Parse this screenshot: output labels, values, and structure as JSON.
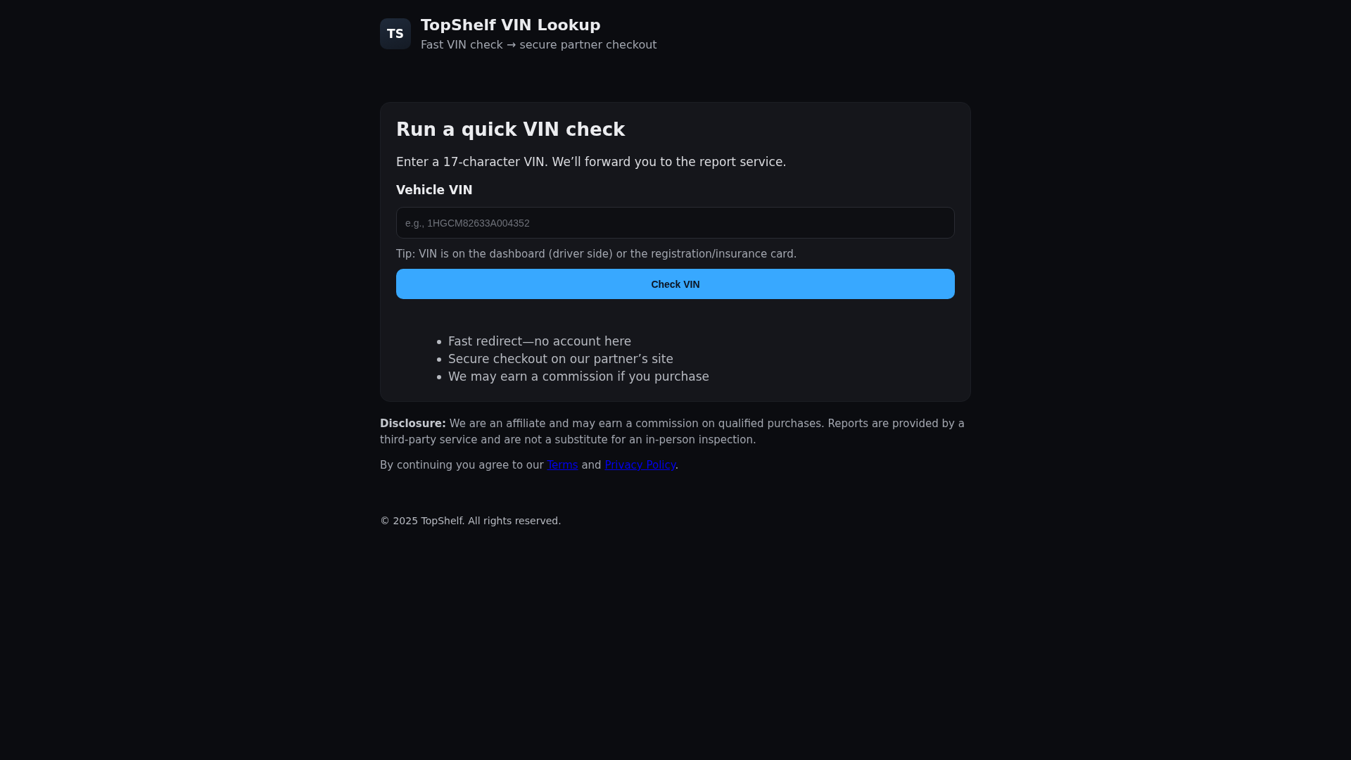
{
  "brand": {
    "logo": "TS",
    "title": "TopShelf VIN Lookup",
    "subtitle": "Fast VIN check → secure partner checkout"
  },
  "card": {
    "heading": "Run a quick VIN check",
    "intro": "Enter a 17-character VIN. We’ll forward you to the report service.",
    "field_label": "Vehicle VIN",
    "vin_field": {
      "placeholder": "e.g., 1HGCM82633A004352"
    },
    "tip": "Tip: VIN is on the dashboard (driver side) or the registration/insurance card.",
    "button": "Check VIN",
    "bullets": [
      "Fast redirect—no account here",
      "Secure checkout on our partner’s site",
      "We may earn a commission if you purchase"
    ]
  },
  "disclosure": "**Disclosure:** We are an affiliate and may earn a commission on qualified purchases. Reports are provided by a third-party service and are not a substitute for an in-person inspection.",
  "agreement": [
    {
      "kind": "text",
      "text": "By continuing you agree to our "
    },
    {
      "kind": "link",
      "text": "Terms"
    },
    {
      "kind": "text",
      "text": " and "
    },
    {
      "kind": "link",
      "text": "Privacy Policy"
    },
    {
      "kind": "text",
      "text": "."
    }
  ],
  "footer": "© 2025 TopShelf. All rights reserved."
}
